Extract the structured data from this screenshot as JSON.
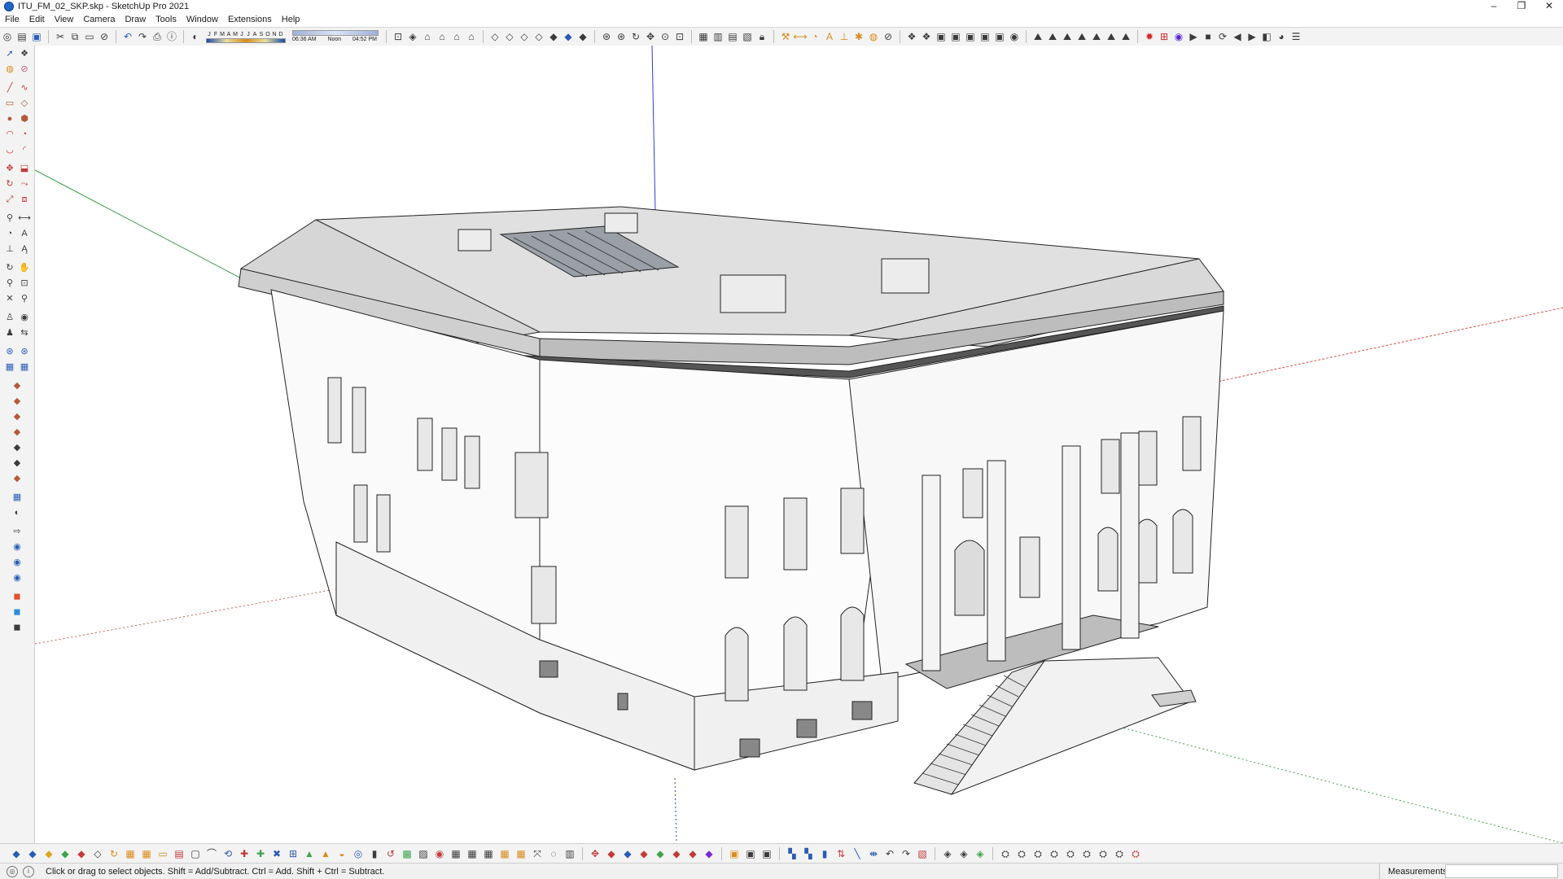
{
  "window": {
    "title": "ITU_FM_02_SKP.skp - SketchUp Pro 2021",
    "app_icon": "sketchup-icon",
    "controls": {
      "minimize": "–",
      "restore": "❐",
      "close": "✕"
    }
  },
  "menu": [
    "File",
    "Edit",
    "View",
    "Camera",
    "Draw",
    "Tools",
    "Window",
    "Extensions",
    "Help"
  ],
  "shadows": {
    "months": [
      "J",
      "F",
      "M",
      "A",
      "M",
      "J",
      "J",
      "A",
      "S",
      "O",
      "N",
      "D"
    ],
    "time_start": "06:36 AM",
    "time_mid": "Noon",
    "time_end": "04:52 PM"
  },
  "status": {
    "hint": "Click or drag to select objects. Shift = Add/Subtract. Ctrl = Add. Shift + Ctrl = Subtract.",
    "measurements_label": "Measurements",
    "measurements_value": ""
  },
  "colors": {
    "x_axis": "#d9534f",
    "y_axis": "#3fa34d",
    "z_axis": "#2d3fd6",
    "toolbar_bg": "#f3f3f3"
  }
}
